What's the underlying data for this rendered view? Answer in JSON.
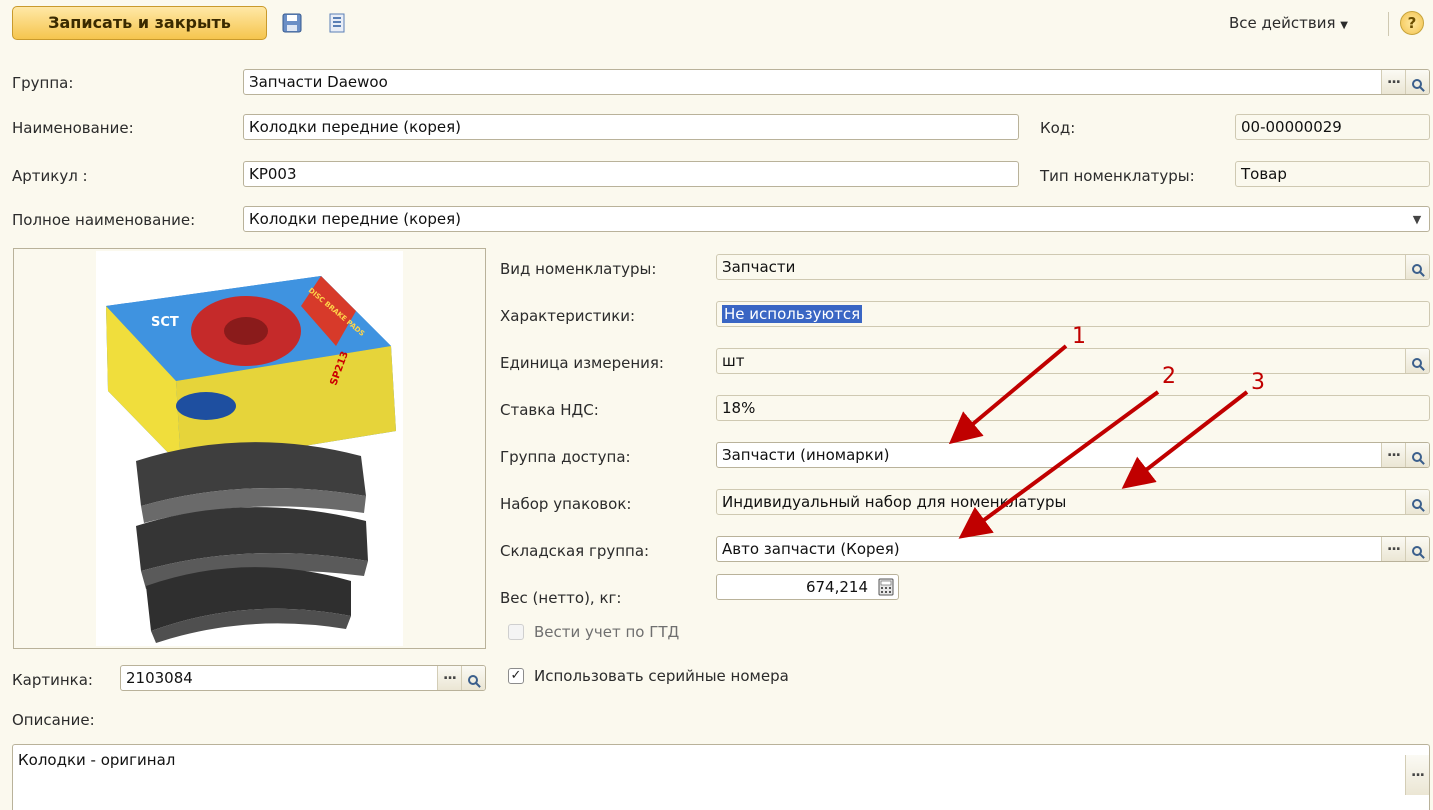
{
  "toolbar": {
    "save_close_label": "Записать и закрыть",
    "all_actions_label": "Все действия",
    "help_glyph": "?"
  },
  "form": {
    "group_label": "Группа:",
    "group_value": "Запчасти Daewoo",
    "name_label": "Наименование:",
    "name_value": "Колодки передние (корея)",
    "code_label": "Код:",
    "code_value": "00-00000029",
    "article_label": "Артикул :",
    "article_value": "KP003",
    "type_label": "Тип номенклатуры:",
    "type_value": "Товар",
    "fullname_label": "Полное наименование:",
    "fullname_value": "Колодки передние (корея)",
    "kind_label": "Вид номенклатуры:",
    "kind_value": "Запчасти",
    "chars_label": "Характеристики:",
    "chars_value": "Не используются",
    "unit_label": "Единица измерения:",
    "unit_value": "шт",
    "vat_label": "Ставка НДС:",
    "vat_value": "18%",
    "access_label": "Группа доступа:",
    "access_value": "Запчасти (иномарки)",
    "pack_label": "Набор упаковок:",
    "pack_value": "Индивидуальный набор для номенклатуры",
    "stock_label": "Складская группа:",
    "stock_value": "Авто запчасти (Корея)",
    "weight_label": "Вес (нетто), кг:",
    "weight_value": "674,214",
    "gtd_label": "Вести учет по ГТД",
    "serial_label": "Использовать серийные номера",
    "picture_label": "Картинка:",
    "picture_value": "2103084",
    "desc_label": "Описание:",
    "desc_value": "Колодки - оригинал"
  },
  "annotations": {
    "n1": "1",
    "n2": "2",
    "n3": "3",
    "color": "#c00000"
  },
  "product_image": {
    "box_brand": "SCT",
    "box_code": "SP213",
    "box_strip": "DISC BRAKE PADS"
  },
  "icons": [
    "floppy-icon",
    "list-icon",
    "help-icon",
    "dropdown-arrow-icon",
    "magnifier-icon",
    "calculator-icon",
    "checkmark-icon"
  ]
}
